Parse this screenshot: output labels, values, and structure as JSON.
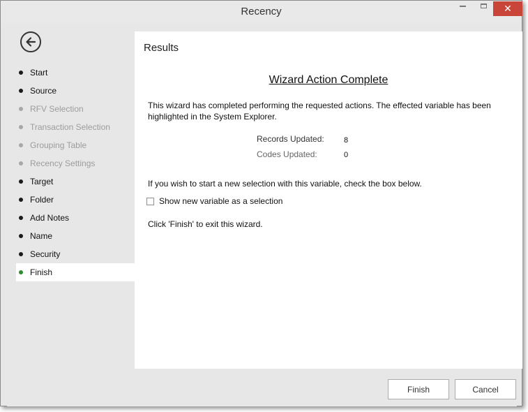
{
  "window": {
    "title": "Recency",
    "controls": {
      "minimize": "",
      "maximize": "",
      "close": "✕"
    }
  },
  "sidebar": {
    "back_icon": "back-arrow-icon",
    "items": [
      {
        "label": "Start",
        "state": "enabled"
      },
      {
        "label": "Source",
        "state": "enabled"
      },
      {
        "label": "RFV Selection",
        "state": "disabled"
      },
      {
        "label": "Transaction Selection",
        "state": "disabled"
      },
      {
        "label": "Grouping Table",
        "state": "disabled"
      },
      {
        "label": "Recency Settings",
        "state": "disabled"
      },
      {
        "label": "Target",
        "state": "enabled"
      },
      {
        "label": "Folder",
        "state": "enabled"
      },
      {
        "label": "Add Notes",
        "state": "enabled"
      },
      {
        "label": "Name",
        "state": "enabled"
      },
      {
        "label": "Security",
        "state": "enabled"
      },
      {
        "label": "Finish",
        "state": "active"
      }
    ]
  },
  "main": {
    "section_title": "Results",
    "heading": "Wizard Action Complete",
    "description": "This wizard has completed performing the requested actions. The effected variable has been highlighted in the System Explorer.",
    "stats": {
      "records_label": "Records Updated:",
      "records_value": "8",
      "codes_label": "Codes Updated:",
      "codes_value": "0"
    },
    "prompt": "If you wish to start a new selection with this variable, check the box below.",
    "checkbox_label": "Show new variable as a selection",
    "checkbox_checked": false,
    "exit_text": "Click 'Finish' to exit this wizard."
  },
  "footer": {
    "finish_label": "Finish",
    "cancel_label": "Cancel"
  },
  "colors": {
    "active_dot": "#2e8b2e",
    "close_button": "#c9453a",
    "background": "#e7e7e7"
  }
}
